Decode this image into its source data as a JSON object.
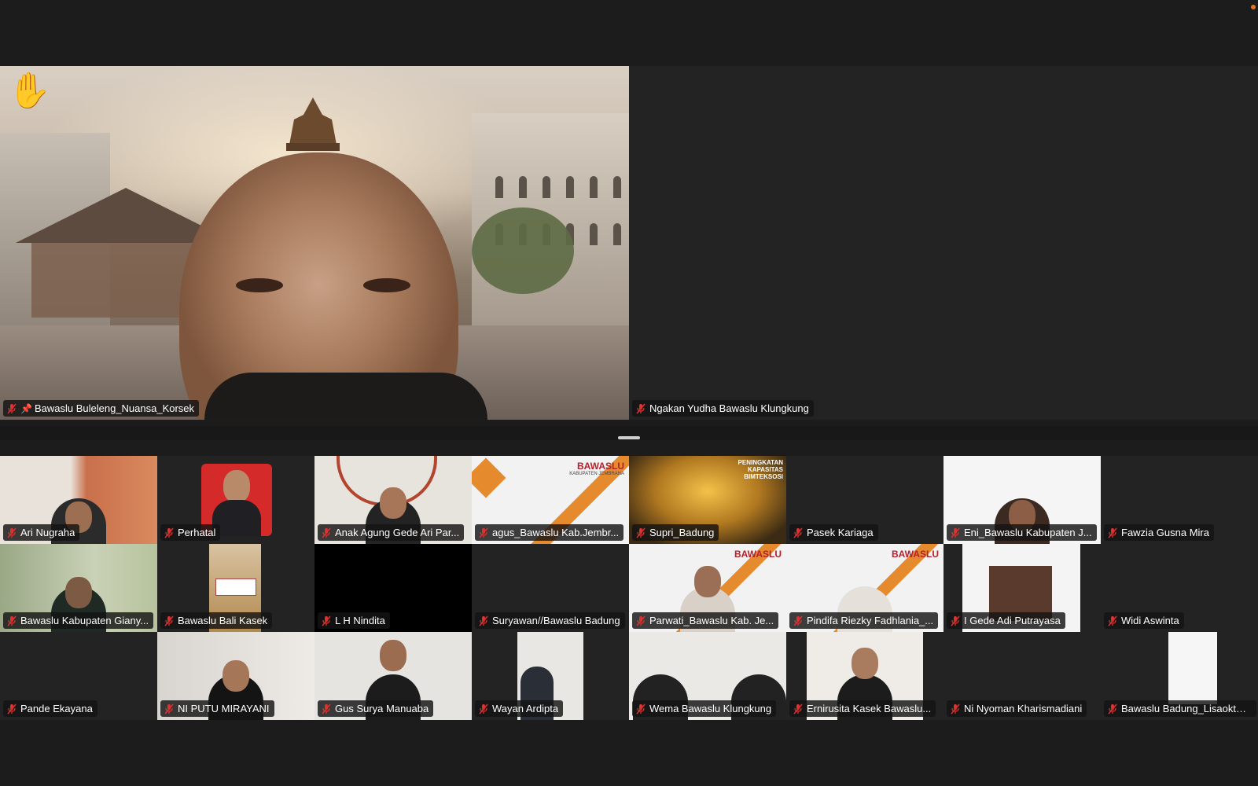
{
  "meeting": {
    "status_colors": {
      "muted": "#e0302e",
      "recording": "#e8731c"
    },
    "spotlight": [
      {
        "name": "Bawaslu Buleleng_Nuansa_Korsek",
        "pinned": true,
        "raised_hand": true,
        "muted": true
      },
      {
        "name": "Ngakan Yudha Bawaslu Klungkung",
        "pinned": false,
        "raised_hand": false,
        "muted": true
      }
    ],
    "gallery": [
      {
        "name": "Ari Nugraha"
      },
      {
        "name": "Perhatal"
      },
      {
        "name": "Anak Agung Gede Ari Par..."
      },
      {
        "name": "agus_Bawaslu Kab.Jembr..."
      },
      {
        "name": "Supri_Badung"
      },
      {
        "name": "Pasek Kariaga"
      },
      {
        "name": "Eni_Bawaslu Kabupaten J..."
      },
      {
        "name": "Fawzia Gusna Mira"
      },
      {
        "name": "Bawaslu Kabupaten Giany..."
      },
      {
        "name": "Bawaslu Bali Kasek"
      },
      {
        "name": "L H Nindita"
      },
      {
        "name": "Suryawan//Bawaslu Badung"
      },
      {
        "name": "Parwati_Bawaslu Kab. Je..."
      },
      {
        "name": "Pindifa Riezky Fadhlania_..."
      },
      {
        "name": "I Gede Adi Putrayasa"
      },
      {
        "name": "Widi Aswinta"
      },
      {
        "name": "Pande Ekayana"
      },
      {
        "name": "NI PUTU MIRAYANI"
      },
      {
        "name": "Gus Surya Manuaba"
      },
      {
        "name": "Wayan Ardipta"
      },
      {
        "name": "Wema Bawaslu Klungkung"
      },
      {
        "name": "Ernirusita Kasek Bawaslu..."
      },
      {
        "name": "Ni Nyoman Kharismadiani"
      },
      {
        "name": "Bawaslu Badung_Lisaoktaviani"
      }
    ],
    "tile_text": {
      "bawaslu_brand": "BAWASLU",
      "bawaslu_sub": "KABUPATEN JEMBRANA",
      "book_title": "PENINGKATAN KAPASITAS BIMTEKSOSI"
    }
  }
}
